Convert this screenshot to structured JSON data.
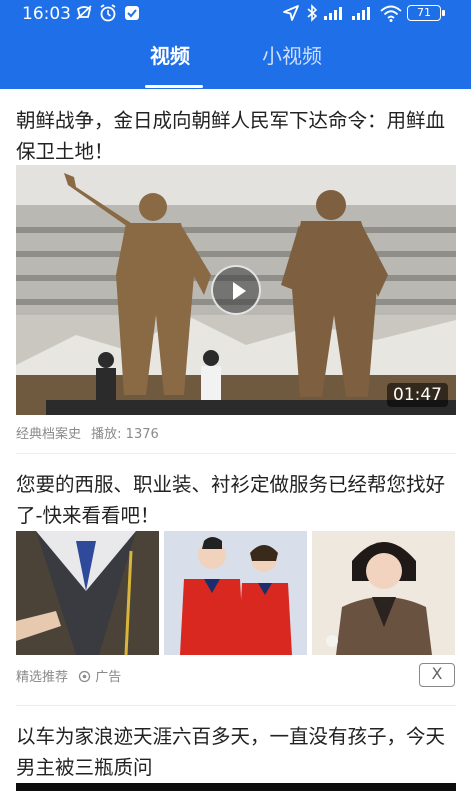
{
  "status_bar": {
    "time": "16:03",
    "battery": "71"
  },
  "tabs": [
    {
      "label": "视频",
      "active": true
    },
    {
      "label": "小视频",
      "active": false
    }
  ],
  "colors": {
    "header": "#1f6fe8"
  },
  "feed": {
    "video_card": {
      "title": "朝鲜战争，金日成向朝鲜人民军下达命令：用鲜血保卫土地！",
      "duration": "01:47",
      "source": "经典档案史",
      "plays": "播放: 1376"
    },
    "ad_card": {
      "title": "您要的西服、职业装、衬衫定做服务已经帮您找好了-快来看看吧！",
      "label": "精选推荐",
      "ad_tag": "广告",
      "close": "X"
    },
    "next_card": {
      "title": "以车为家浪迹天涯六百多天，一直没有孩子，今天男主被三瓶质问"
    }
  }
}
